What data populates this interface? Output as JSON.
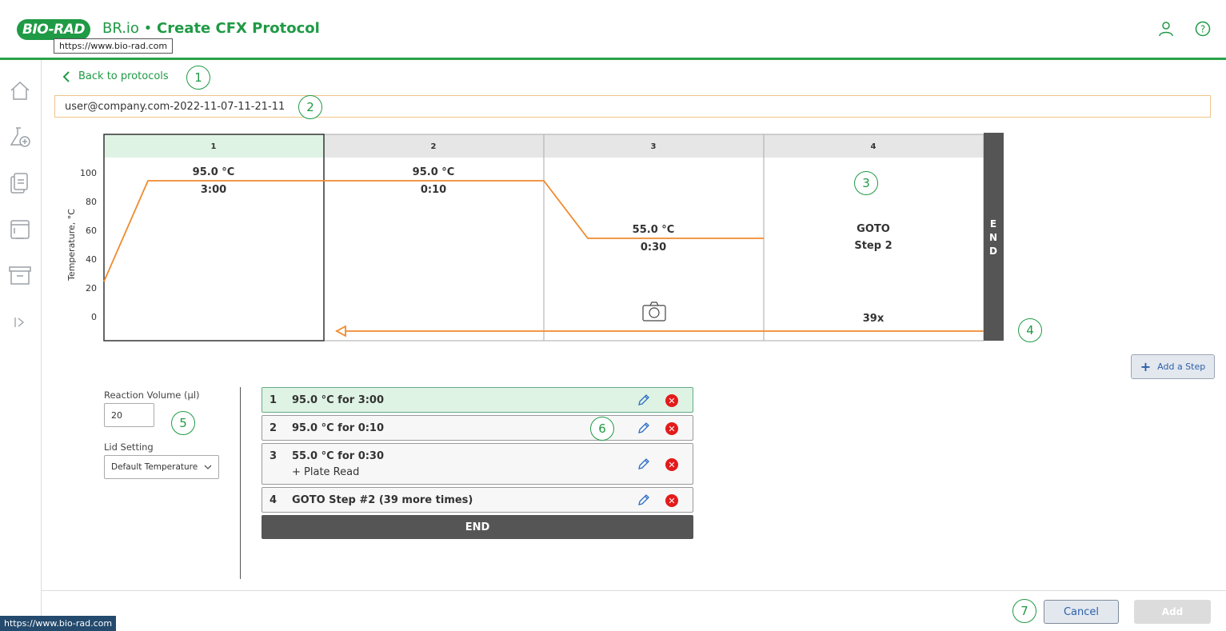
{
  "header": {
    "logo_text": "BIO-RAD",
    "app_name": "BR.io",
    "separator": " • ",
    "page_title": "Create CFX Protocol",
    "tooltip_url": "https://www.bio-rad.com",
    "icons": [
      "user-icon",
      "help-icon"
    ]
  },
  "sidebar": {
    "items": [
      "home-icon",
      "flask-add-icon",
      "documents-icon",
      "instrument-icon",
      "archive-icon",
      "expand-icon"
    ]
  },
  "callouts": [
    "1",
    "2",
    "3",
    "4",
    "5",
    "6",
    "7"
  ],
  "back_link": "Back to protocols",
  "protocol_name": "user@company.com-2022-11-07-11-21-11",
  "chart": {
    "ylabel": "Temperature, °C",
    "yticks": [
      "100",
      "80",
      "60",
      "40",
      "20",
      "0"
    ],
    "columns": [
      {
        "num": "1",
        "temp": "95.0 °C",
        "time": "3:00"
      },
      {
        "num": "2",
        "temp": "95.0 °C",
        "time": "0:10"
      },
      {
        "num": "3",
        "temp": "55.0 °C",
        "time": "0:30"
      },
      {
        "num": "4",
        "goto": "GOTO",
        "goto_step": "Step 2",
        "repeats": "39x"
      }
    ],
    "end_label": "END",
    "line_color": "#f08a2e"
  },
  "add_step_label": "Add a Step",
  "reaction_volume": {
    "label": "Reaction Volume (µl)",
    "value": "20"
  },
  "lid_setting": {
    "label": "Lid Setting",
    "value": "Default Temperature"
  },
  "steps": [
    {
      "num": "1",
      "text": "95.0 °C for 3:00",
      "sub": ""
    },
    {
      "num": "2",
      "text": "95.0 °C for 0:10",
      "sub": ""
    },
    {
      "num": "3",
      "text": "55.0 °C for 0:30",
      "sub": "+ Plate Read"
    },
    {
      "num": "4",
      "text": "GOTO Step #2 (39 more times)",
      "sub": ""
    }
  ],
  "end_bar": "END",
  "buttons": {
    "cancel": "Cancel",
    "add": "Add"
  },
  "status_url": "https://www.bio-rad.com"
}
